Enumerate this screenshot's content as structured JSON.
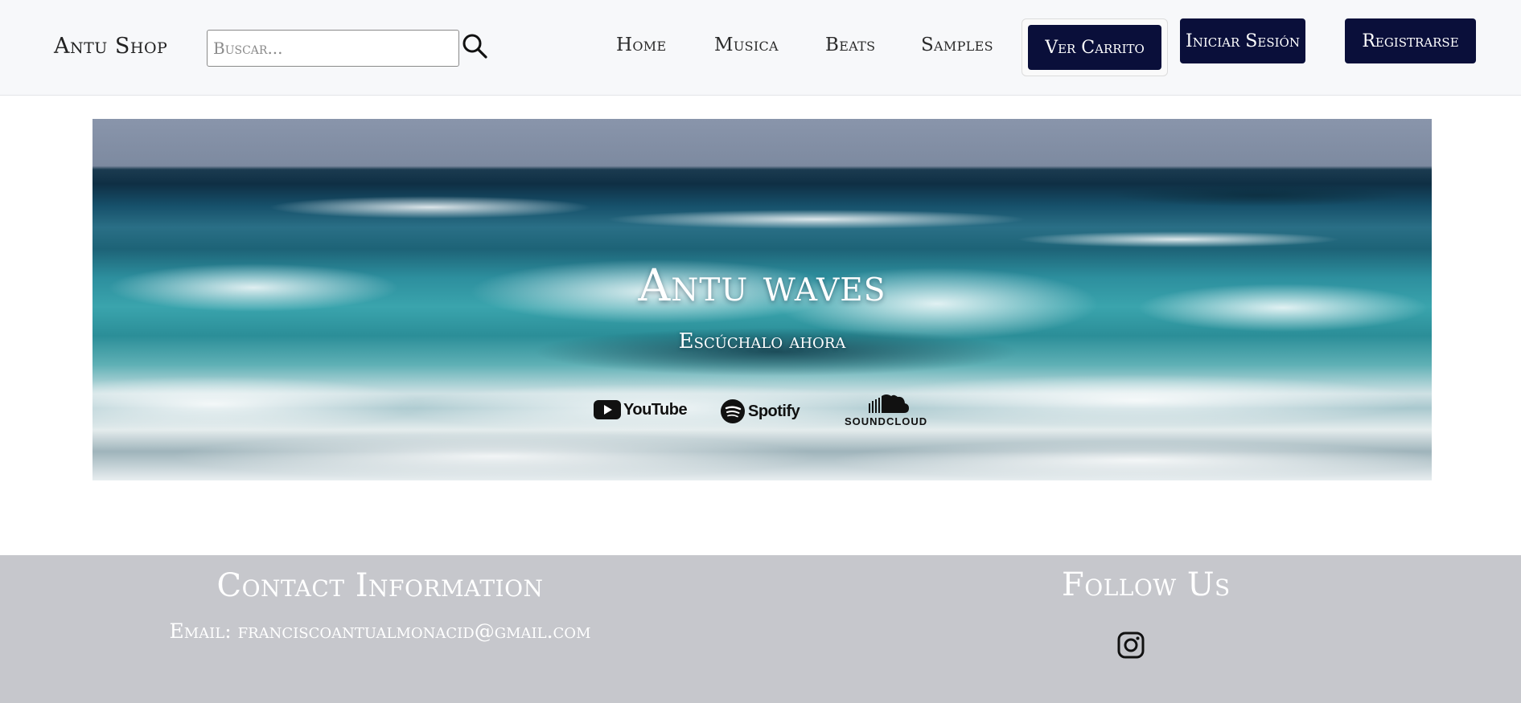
{
  "header": {
    "brand": "Antu Shop",
    "search": {
      "placeholder": "Buscar...",
      "value": ""
    },
    "nav": [
      {
        "label": "Home"
      },
      {
        "label": "Musica"
      },
      {
        "label": "Beats"
      },
      {
        "label": "Samples"
      }
    ],
    "cart_label": "Ver Carrito",
    "login_label": "Iniciar Sesión",
    "register_label": "Registrarse",
    "button_color": "#0a0f3a"
  },
  "hero": {
    "title": "Antu waves",
    "subtitle": "Escúchalo ahora",
    "platforms": [
      {
        "label": "YouTube",
        "icon": "youtube-icon"
      },
      {
        "label": "Spotify",
        "icon": "spotify-icon"
      },
      {
        "label": "SOUNDCLOUD",
        "icon": "soundcloud-icon"
      }
    ]
  },
  "footer": {
    "contact_title": "Contact Information",
    "contact_email": "Email: franciscoantualmonacid@gmail.com",
    "follow_title": "Follow Us",
    "social_icon": "instagram-icon",
    "background": "#c6c7cc"
  }
}
